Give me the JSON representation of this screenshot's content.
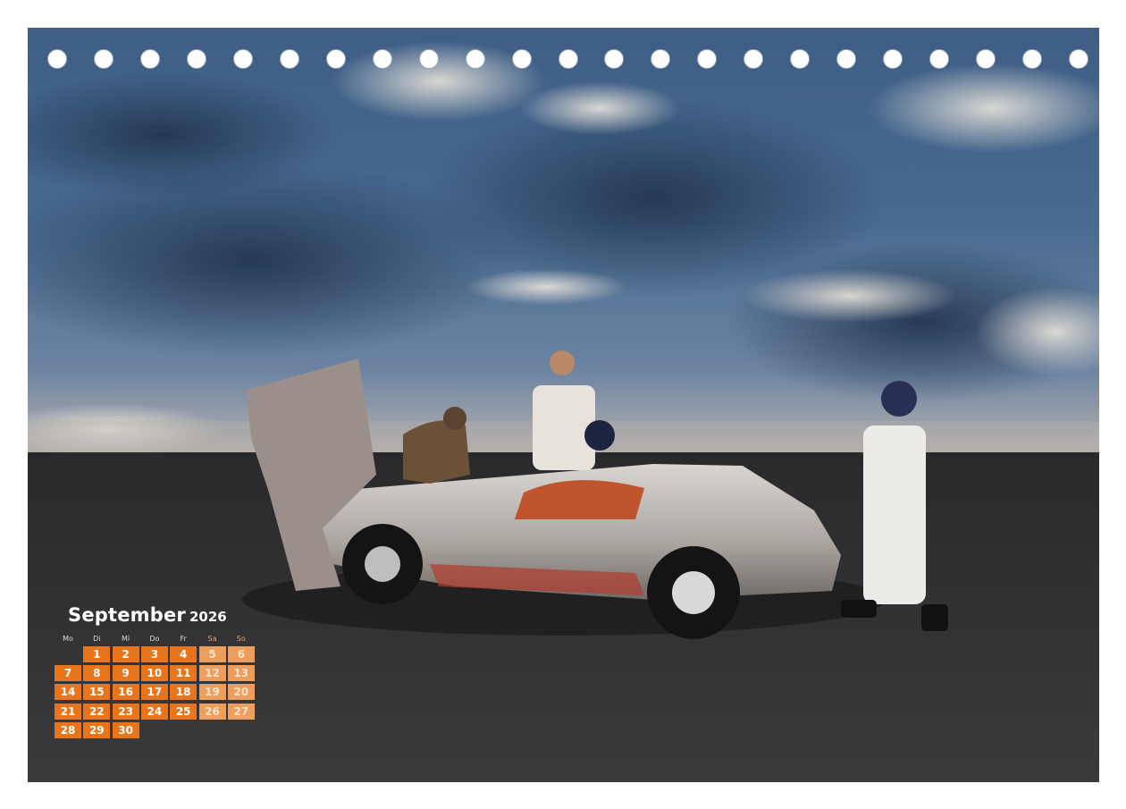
{
  "calendar": {
    "month": "September",
    "year": "2026",
    "weekdays": [
      "Mo",
      "Di",
      "Mi",
      "Do",
      "Fr",
      "Sa",
      "So"
    ],
    "weekend_color": "#ee9e5c",
    "day_color": "#e8751c",
    "first_weekday_index": 1,
    "days_in_month": 30
  },
  "photo": {
    "subject": "toy race car with mechanic figures"
  },
  "binding_holes": 23
}
